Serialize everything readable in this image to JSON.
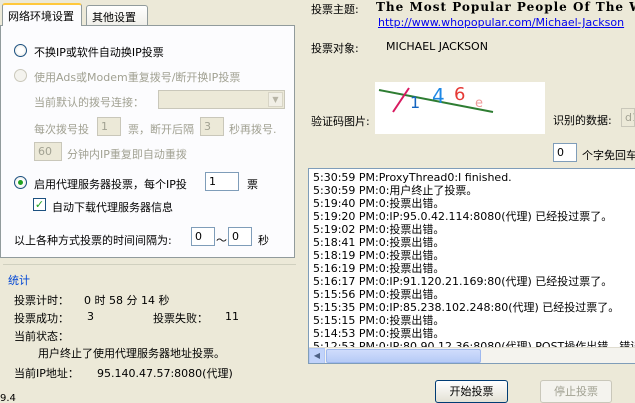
{
  "tabs": [
    "网络环境设置",
    "其他设置"
  ],
  "network": {
    "no_ip_change": "不换IP或软件自动换IP投票",
    "use_adsl": "使用Ads或Modem重复拨号/断开换IP投票",
    "current_dial_label": "当前默认的拨号连接：",
    "dial_every_prefix": "每次拨号投",
    "dial_count": "1",
    "dial_every_mid": "票，断开后隔",
    "wait_seconds": "3",
    "dial_every_suffix": "秒再拨号.",
    "repeat_minutes": "60",
    "repeat_suffix": "分钟内IP重复即自动重拨",
    "use_proxy": "启用代理服务器投票，每个IP投",
    "per_ip_votes": "1",
    "per_ip_unit": "票",
    "auto_download_proxy": "自动下载代理服务器信息",
    "interval_label": "以上各种方式投票的时间间隔为:",
    "interval_min": "0",
    "interval_sep": "～",
    "interval_max": "0",
    "interval_unit": "秒"
  },
  "stats": {
    "section_title": "统计",
    "vote_time_label": "投票计时：",
    "vote_time_value": "0 时 58 分 14 秒",
    "success_label": "投票成功：",
    "success_value": "3",
    "fail_label": "投票失败：",
    "fail_value": "11",
    "status_label": "当前状态：",
    "status_value": "用户终止了使用代理服务器地址投票。",
    "ip_label": "当前IP地址：",
    "ip_value": "95.140.47.57:8080(代理)"
  },
  "vote": {
    "topic_label": "投票主题:",
    "topic_value": "The Most Popular People Of The W",
    "topic_url": "http://www.whopopular.com/Michael-Jackson",
    "object_label": "投票对象:",
    "object_value": "MICHAEL JACKSON",
    "captcha_label": "验证码图片:",
    "captcha_chars": [
      "1",
      "4",
      "6",
      "e"
    ],
    "recognized_label": "识别的数据:",
    "recognized_value": "d1",
    "skip_count": "0",
    "skip_label": "个字免回车"
  },
  "log": [
    "5:30:59 PM:ProxyThread0:I finished.",
    "5:30:59 PM:0:用户终止了投票。",
    "5:19:40 PM:0:投票出错。",
    "5:19:20 PM:0:IP:95.0.42.114:8080(代理) 已经投过票了。",
    "5:19:02 PM:0:投票出错。",
    "5:18:41 PM:0:投票出错。",
    "5:18:19 PM:0:投票出错。",
    "5:16:19 PM:0:投票出错。",
    "5:16:17 PM:0:IP:91.120.21.169:80(代理) 已经投过票了。",
    "5:15:56 PM:0:投票出错。",
    "5:15:35 PM:0:IP:85.238.102.248:80(代理) 已经投过票了。",
    "5:15:15 PM:0:投票出错。",
    "5:14:53 PM:0:投票出错。",
    "5:12:53 PM:0:IP:80.90.12.36:8080(代理) POST操作出错，错误信"
  ],
  "buttons": {
    "start": "开始投票",
    "stop": "停止投票"
  },
  "version": "9.4"
}
